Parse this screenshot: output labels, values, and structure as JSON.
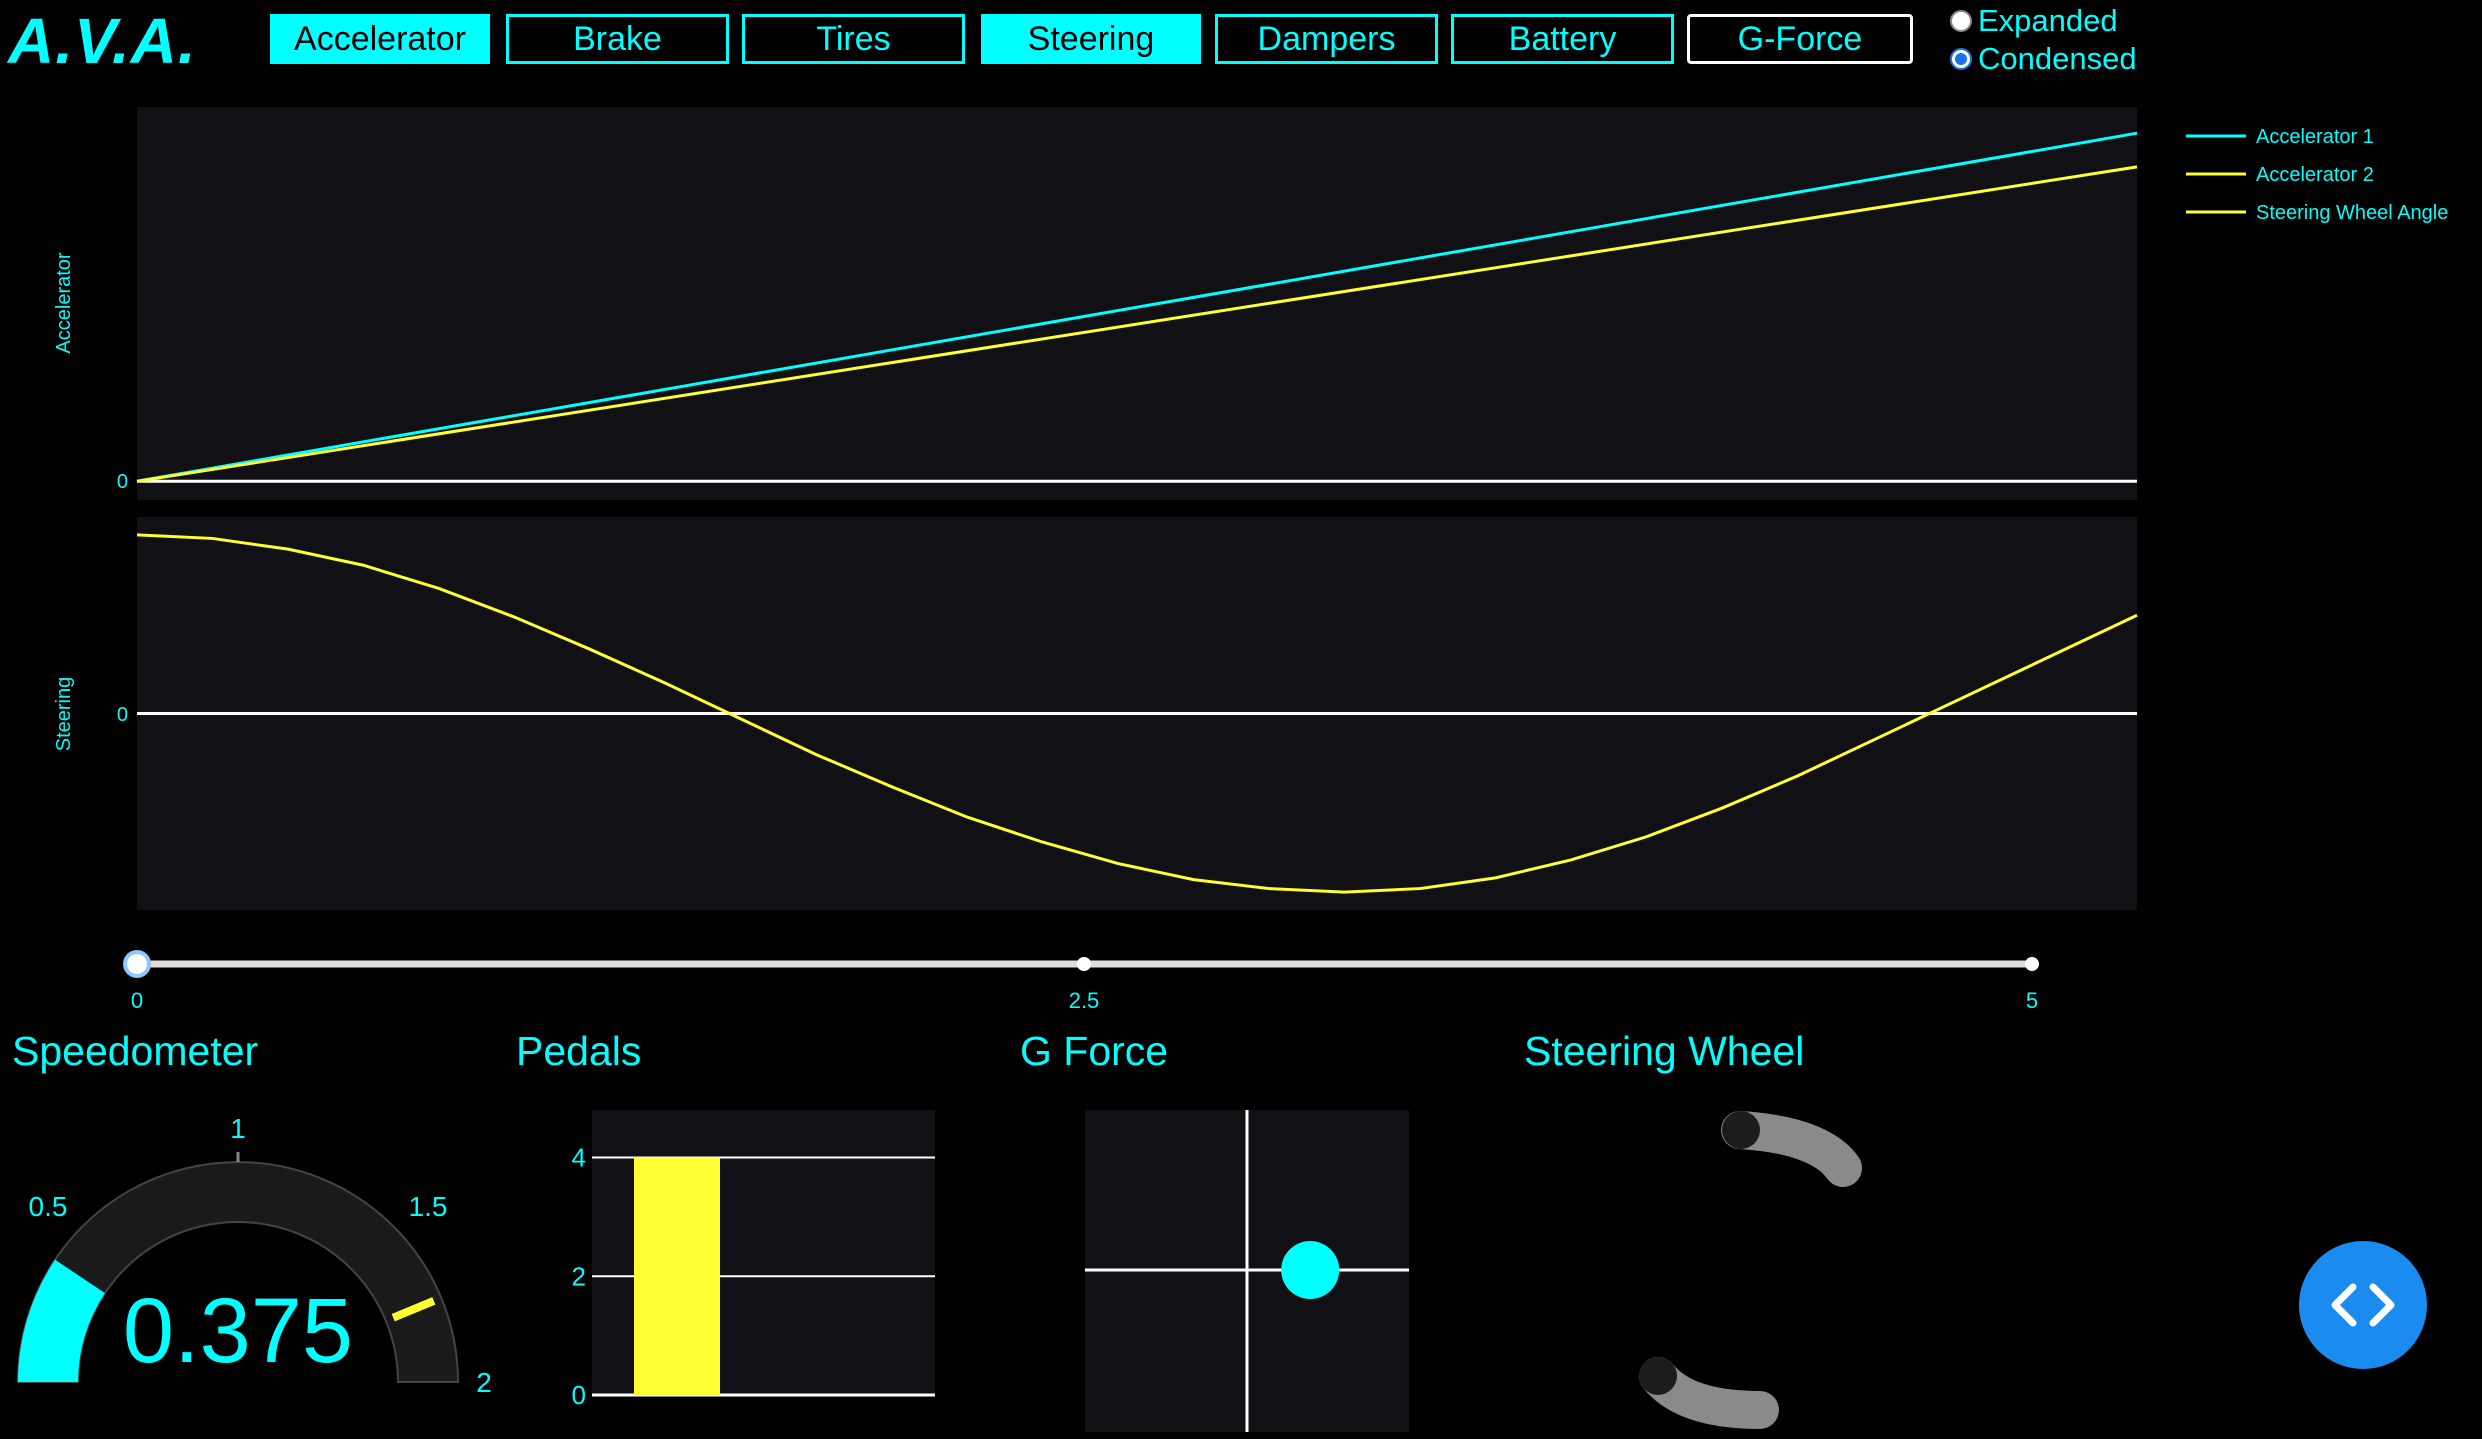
{
  "app": {
    "logo": "A.V.A."
  },
  "tabs": [
    {
      "label": "Accelerator",
      "active": true
    },
    {
      "label": "Brake",
      "active": false
    },
    {
      "label": "Tires",
      "active": false
    },
    {
      "label": "Steering",
      "active": true
    },
    {
      "label": "Dampers",
      "active": false
    },
    {
      "label": "Battery",
      "active": false
    },
    {
      "label": "G-Force",
      "active": false
    }
  ],
  "view_mode": {
    "options": [
      "Expanded",
      "Condensed"
    ],
    "selected": "Condensed"
  },
  "colors": {
    "accent": "#00ffff",
    "series2": "#ffff33",
    "panel": "#111115",
    "background": "#000000"
  },
  "chart_data": [
    {
      "type": "line",
      "ylabel": "Accelerator",
      "yticks": [
        "0"
      ],
      "xlim": [
        0,
        5.3
      ],
      "ylim": [
        -0.05,
        1.0
      ],
      "series": [
        {
          "name": "Accelerator 1",
          "color": "#00ffff",
          "x": [
            0,
            5.3
          ],
          "y": [
            0,
            0.93
          ]
        },
        {
          "name": "Accelerator 2",
          "color": "#ffff33",
          "x": [
            0,
            5.3
          ],
          "y": [
            0,
            0.84
          ]
        }
      ]
    },
    {
      "type": "line",
      "ylabel": "Steering",
      "yticks": [
        "0"
      ],
      "xlim": [
        0,
        5.3
      ],
      "ylim": [
        -1.1,
        1.1
      ],
      "series": [
        {
          "name": "Steering Wheel Angle",
          "color": "#ffff33",
          "x": [
            0,
            0.2,
            0.4,
            0.6,
            0.8,
            1.0,
            1.2,
            1.4,
            1.6,
            1.8,
            2.0,
            2.2,
            2.4,
            2.6,
            2.8,
            3.0,
            3.2,
            3.4,
            3.6,
            3.8,
            4.0,
            4.2,
            4.4,
            4.6,
            4.8,
            5.0,
            5.3
          ],
          "y": [
            1.0,
            0.98,
            0.92,
            0.83,
            0.7,
            0.54,
            0.36,
            0.17,
            -0.03,
            -0.23,
            -0.41,
            -0.58,
            -0.72,
            -0.84,
            -0.93,
            -0.98,
            -1.0,
            -0.98,
            -0.92,
            -0.82,
            -0.69,
            -0.53,
            -0.35,
            -0.15,
            0.05,
            0.25,
            0.55
          ]
        }
      ]
    },
    {
      "type": "bar",
      "title": "Pedals",
      "categories": [
        ""
      ],
      "values": [
        4
      ],
      "yticks": [
        "0",
        "2",
        "4"
      ],
      "ylim": [
        0,
        4.8
      ]
    },
    {
      "type": "scatter",
      "title": "G Force",
      "x": [
        0.39
      ],
      "y": [
        0.0
      ],
      "xlim": [
        -1,
        1
      ],
      "ylim": [
        -1,
        1
      ]
    }
  ],
  "legend": {
    "entries": [
      "Accelerator 1",
      "Accelerator 2",
      "Steering Wheel Angle"
    ]
  },
  "time_slider": {
    "ticks": [
      "0",
      "2.5",
      "5"
    ],
    "min": 0,
    "max": 5,
    "value": 0
  },
  "speedometer": {
    "title": "Speedometer",
    "value": 0.375,
    "value_text": "0.375",
    "max": 2,
    "ticks": [
      "1",
      "0.5",
      "1.5",
      "2"
    ],
    "threshold": 1.75
  },
  "pedals": {
    "title": "Pedals"
  },
  "gforce": {
    "title": "G Force"
  },
  "steering_wheel": {
    "title": "Steering Wheel"
  }
}
